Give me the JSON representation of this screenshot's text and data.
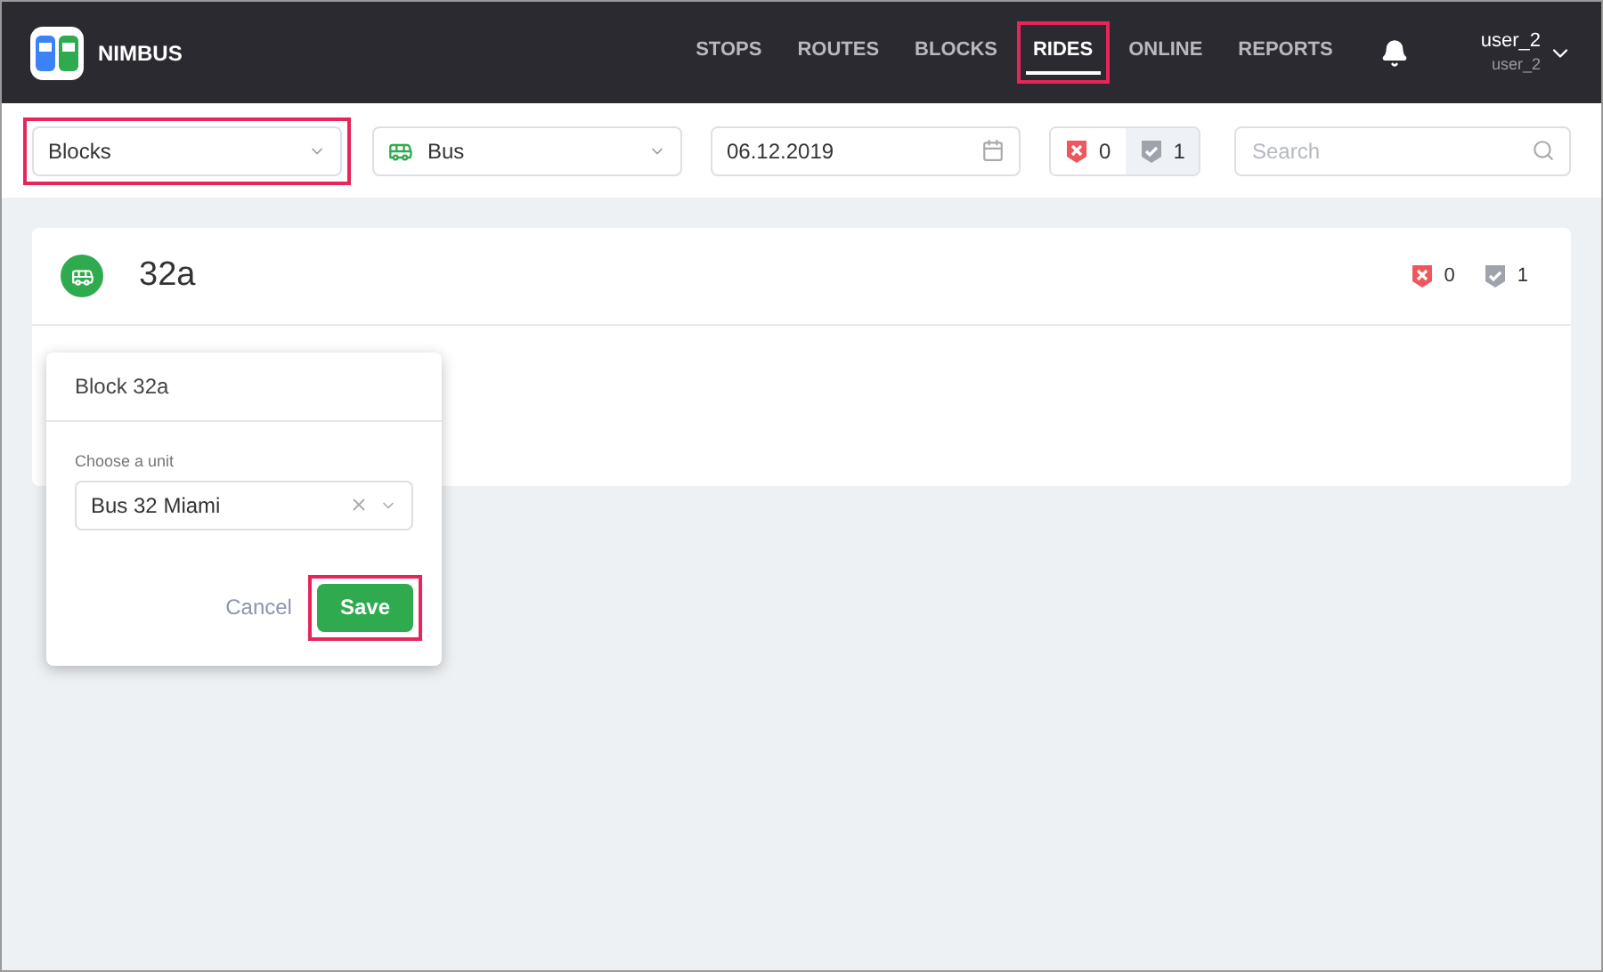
{
  "app": {
    "name": "NIMBUS"
  },
  "nav": [
    {
      "label": "STOPS",
      "selected": false,
      "highlighted": false
    },
    {
      "label": "ROUTES",
      "selected": false,
      "highlighted": false
    },
    {
      "label": "BLOCKS",
      "selected": false,
      "highlighted": false
    },
    {
      "label": "RIDES",
      "selected": true,
      "highlighted": true
    },
    {
      "label": "ONLINE",
      "selected": false,
      "highlighted": false
    },
    {
      "label": "REPORTS",
      "selected": false,
      "highlighted": false
    }
  ],
  "user": {
    "name": "user_2",
    "login": "user_2"
  },
  "filters": {
    "type_select": {
      "value": "Blocks",
      "highlighted": true
    },
    "vehicle_select": {
      "value": "Bus"
    },
    "date": {
      "value": "06.12.2019"
    },
    "counters": [
      {
        "kind": "failed",
        "count": "0",
        "selected": false
      },
      {
        "kind": "done",
        "count": "1",
        "selected": true
      }
    ],
    "search": {
      "placeholder": "Search"
    }
  },
  "block": {
    "title": "32a",
    "counters": [
      {
        "kind": "failed",
        "count": "0"
      },
      {
        "kind": "done",
        "count": "1"
      }
    ]
  },
  "popover": {
    "title": "Block 32a",
    "field_label": "Choose a unit",
    "unit": "Bus 32 Miami",
    "buttons": [
      {
        "kind": "cancel",
        "label": "Cancel",
        "highlighted": false
      },
      {
        "kind": "save",
        "label": "Save",
        "highlighted": true
      }
    ]
  }
}
